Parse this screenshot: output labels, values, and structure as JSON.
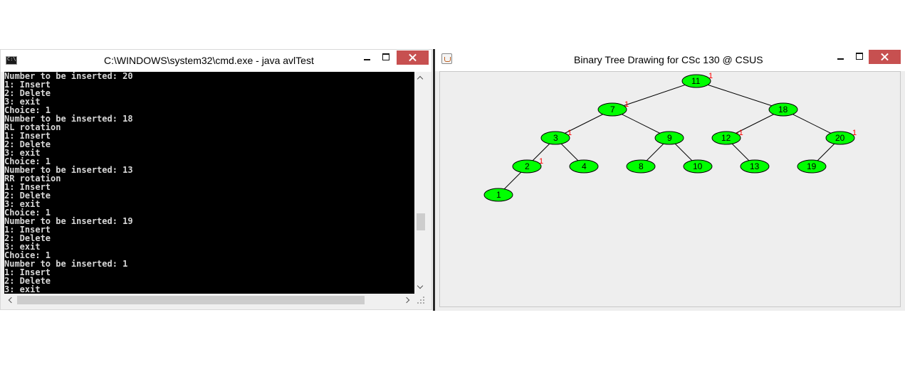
{
  "cmd_window": {
    "title": "C:\\WINDOWS\\system32\\cmd.exe - java  avlTest",
    "icon": "cmd-icon",
    "console_lines": [
      "Number to be inserted: 20",
      "1: Insert",
      "2: Delete",
      "3: exit",
      "Choice: 1",
      "Number to be inserted: 18",
      "RL rotation",
      "1: Insert",
      "2: Delete",
      "3: exit",
      "Choice: 1",
      "Number to be inserted: 13",
      "RR rotation",
      "1: Insert",
      "2: Delete",
      "3: exit",
      "Choice: 1",
      "Number to be inserted: 19",
      "1: Insert",
      "2: Delete",
      "3: exit",
      "Choice: 1",
      "Number to be inserted: 1",
      "1: Insert",
      "2: Delete",
      "3: exit"
    ]
  },
  "tree_window": {
    "title": "Binary Tree Drawing for CSc 130 @ CSUS",
    "icon": "java-icon",
    "node_color": "#00ff00",
    "balance_color": "#ff0000",
    "nodes": [
      {
        "id": "n11",
        "label": "11",
        "balance": "1"
      },
      {
        "id": "n7",
        "label": "7",
        "balance": "1"
      },
      {
        "id": "n18",
        "label": "18",
        "balance": ""
      },
      {
        "id": "n3",
        "label": "3",
        "balance": "1"
      },
      {
        "id": "n9",
        "label": "9",
        "balance": ""
      },
      {
        "id": "n12",
        "label": "12",
        "balance": "-1"
      },
      {
        "id": "n20",
        "label": "20",
        "balance": "1"
      },
      {
        "id": "n2",
        "label": "2",
        "balance": "1"
      },
      {
        "id": "n4",
        "label": "4",
        "balance": ""
      },
      {
        "id": "n8",
        "label": "8",
        "balance": ""
      },
      {
        "id": "n10",
        "label": "10",
        "balance": ""
      },
      {
        "id": "n13",
        "label": "13",
        "balance": ""
      },
      {
        "id": "n19",
        "label": "19",
        "balance": ""
      },
      {
        "id": "n1",
        "label": "1",
        "balance": ""
      }
    ],
    "edges": [
      [
        "n11",
        "n7"
      ],
      [
        "n11",
        "n18"
      ],
      [
        "n7",
        "n3"
      ],
      [
        "n7",
        "n9"
      ],
      [
        "n18",
        "n12"
      ],
      [
        "n18",
        "n20"
      ],
      [
        "n3",
        "n2"
      ],
      [
        "n3",
        "n4"
      ],
      [
        "n9",
        "n8"
      ],
      [
        "n9",
        "n10"
      ],
      [
        "n12",
        "n13"
      ],
      [
        "n20",
        "n19"
      ],
      [
        "n2",
        "n1"
      ]
    ]
  }
}
